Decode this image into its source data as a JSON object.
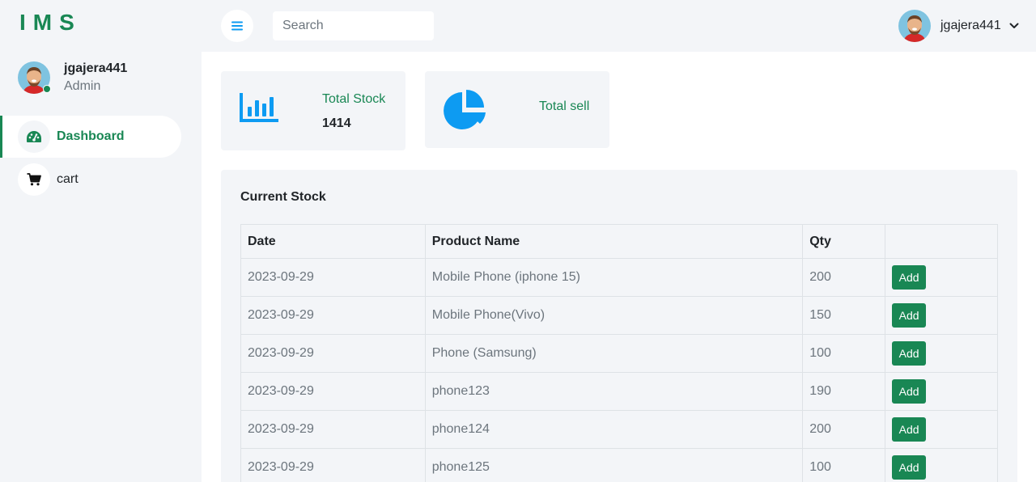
{
  "brand": "IMS",
  "sidebar": {
    "profile": {
      "name": "jgajera441",
      "role": "Admin"
    },
    "items": [
      {
        "label": "Dashboard",
        "icon": "speedometer-icon",
        "active": true
      },
      {
        "label": "cart",
        "icon": "cart-icon",
        "active": false
      }
    ]
  },
  "topbar": {
    "search_placeholder": "Search",
    "username": "jgajera441"
  },
  "cards": {
    "total_stock": {
      "label": "Total Stock",
      "value": "1414",
      "icon": "bar-chart-icon"
    },
    "total_sell": {
      "label": "Total sell",
      "icon": "pie-chart-icon"
    }
  },
  "stock": {
    "title": "Current Stock",
    "headers": [
      "Date",
      "Product Name",
      "Qty",
      ""
    ],
    "add_label": "Add",
    "rows": [
      {
        "date": "2023-09-29",
        "name": "Mobile Phone (iphone 15)",
        "qty": "200"
      },
      {
        "date": "2023-09-29",
        "name": "Mobile Phone(Vivo)",
        "qty": "150"
      },
      {
        "date": "2023-09-29",
        "name": "Phone (Samsung)",
        "qty": "100"
      },
      {
        "date": "2023-09-29",
        "name": "phone123",
        "qty": "190"
      },
      {
        "date": "2023-09-29",
        "name": "phone124",
        "qty": "200"
      },
      {
        "date": "2023-09-29",
        "name": "phone125",
        "qty": "100"
      }
    ]
  },
  "colors": {
    "accent": "#198754",
    "icon_blue": "#0d9bf2",
    "background": "#f3f5f8"
  }
}
